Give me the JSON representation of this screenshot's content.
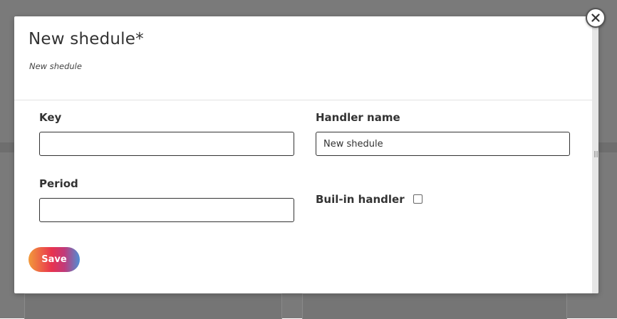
{
  "modal": {
    "title": "New shedule*",
    "subtitle": "New shedule"
  },
  "form": {
    "key": {
      "label": "Key",
      "value": "",
      "placeholder": ""
    },
    "handler_name": {
      "label": "Handler name",
      "value": "New shedule",
      "placeholder": ""
    },
    "period": {
      "label": "Period",
      "value": "",
      "placeholder": ""
    },
    "builtin_handler": {
      "label": "Buil-in handler",
      "checked": false
    }
  },
  "actions": {
    "save_label": "Save",
    "close_icon": "close-icon"
  },
  "colors": {
    "backdrop": "#7a7a7a",
    "save_gradient_start": "#f29a3a",
    "save_gradient_mid": "#e8334f",
    "save_gradient_end": "#4e8fd6"
  }
}
